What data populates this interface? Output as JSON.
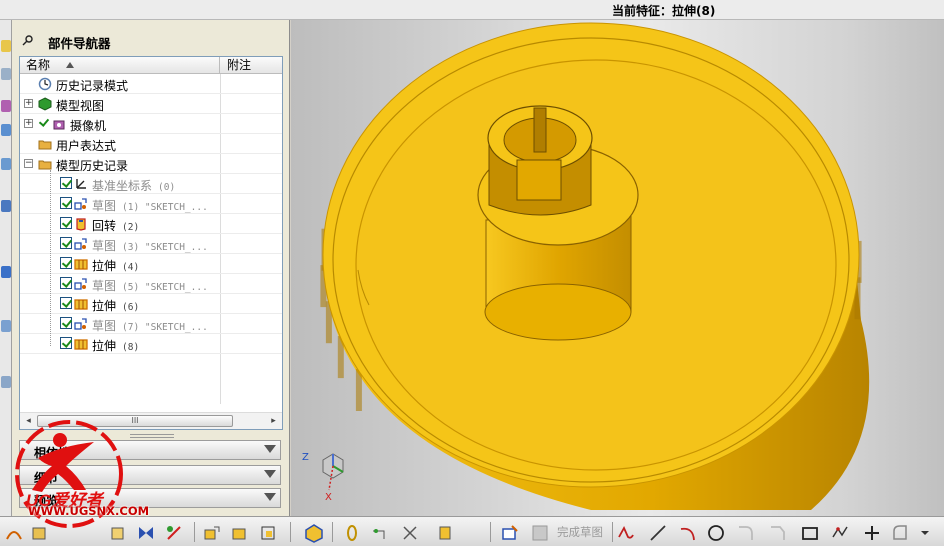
{
  "status_bar": {
    "current_feature": "当前特征：拉伸(8)"
  },
  "navigator": {
    "title": "部件导航器",
    "columns": {
      "name": "名称",
      "note": "附注"
    },
    "items": [
      {
        "label": "历史记录模式",
        "icon": "clock-icon",
        "level": 1,
        "expander": "",
        "dim": false
      },
      {
        "label": "模型视图",
        "icon": "model-views-icon",
        "level": 1,
        "expander": "+",
        "dim": false
      },
      {
        "label": "摄像机",
        "icon": "camera-icon",
        "level": 1,
        "expander": "+",
        "dim": false,
        "checked": true
      },
      {
        "label": "用户表达式",
        "icon": "folder-icon",
        "level": 1,
        "expander": "",
        "dim": false
      },
      {
        "label": "模型历史记录",
        "icon": "folder-open-icon",
        "level": 1,
        "expander": "-",
        "dim": false
      },
      {
        "label": "基准坐标系",
        "sub": "(0)",
        "icon": "datum-csys-icon",
        "level": 2,
        "dim": true
      },
      {
        "label": "草图",
        "sub": "(1) \"SKETCH_...",
        "icon": "sketch-icon",
        "level": 2,
        "dim": true
      },
      {
        "label": "回转",
        "sub": "(2)",
        "icon": "revolve-icon",
        "level": 2,
        "dim": false
      },
      {
        "label": "草图",
        "sub": "(3) \"SKETCH_...",
        "icon": "sketch-icon",
        "level": 2,
        "dim": true
      },
      {
        "label": "拉伸",
        "sub": "(4)",
        "icon": "extrude-icon",
        "level": 2,
        "dim": false
      },
      {
        "label": "草图",
        "sub": "(5) \"SKETCH_...",
        "icon": "sketch-icon",
        "level": 2,
        "dim": true
      },
      {
        "label": "拉伸",
        "sub": "(6)",
        "icon": "extrude-icon",
        "level": 2,
        "dim": false
      },
      {
        "label": "草图",
        "sub": "(7) \"SKETCH_...",
        "icon": "sketch-icon",
        "level": 2,
        "dim": true
      },
      {
        "label": "拉伸",
        "sub": "(8)",
        "icon": "extrude-icon",
        "level": 2,
        "dim": false
      }
    ],
    "scrollbar_grip": "III",
    "panels": [
      {
        "label": "相依性",
        "icon": "chevron-down-icon"
      },
      {
        "label": "细节",
        "icon": "chevron-down-icon"
      },
      {
        "label": "预览",
        "icon": "chevron-down-icon"
      }
    ]
  },
  "toolbar": {
    "finish_sketch_label": "完成草图"
  },
  "watermark": {
    "text": "WWW.UGSNX.COM",
    "logo": "UG爱好者"
  },
  "colors": {
    "part_yellow": "#f5c518",
    "part_shadow": "#c99400",
    "part_dark": "#8a6200",
    "panel_bg": "#ece9d8",
    "checkbox_green": "#1a8a1a"
  },
  "triad": {
    "z_label": "Z",
    "x_label": "X"
  }
}
